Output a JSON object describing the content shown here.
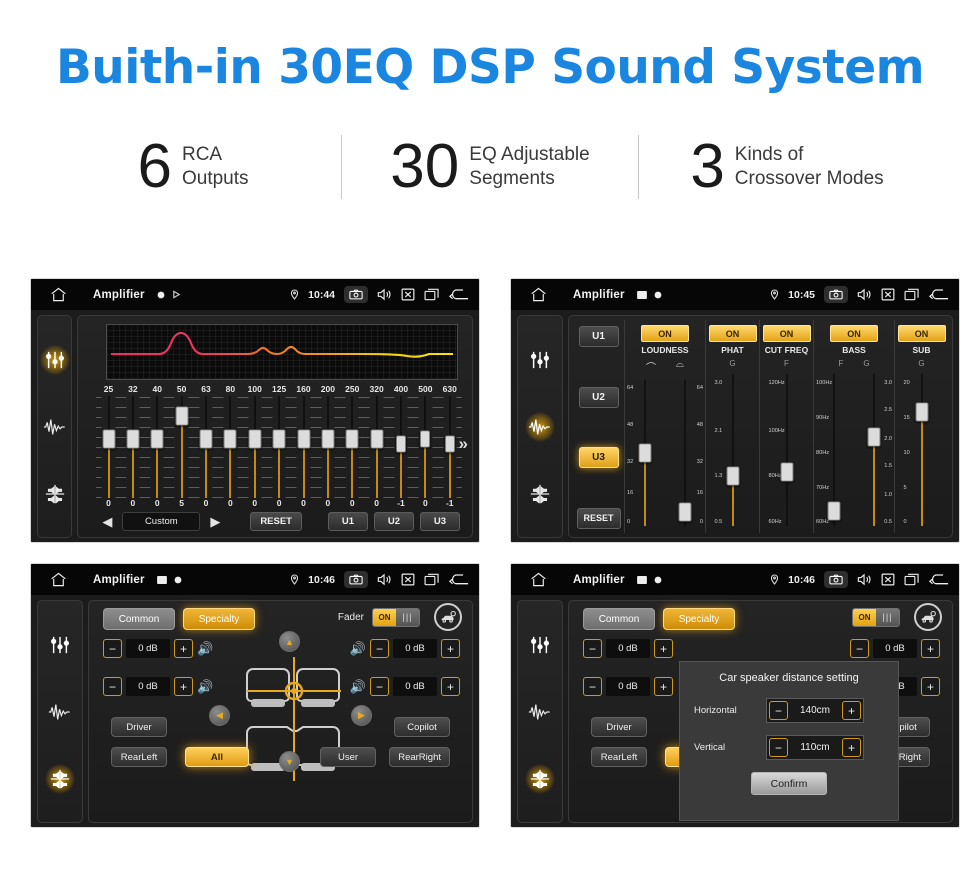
{
  "header": {
    "title": "Buith-in 30EQ DSP Sound System",
    "title_color": "#1a86e0",
    "stats": [
      {
        "number": "6",
        "line1": "RCA",
        "line2": "Outputs"
      },
      {
        "number": "30",
        "line1": "EQ Adjustable",
        "line2": "Segments"
      },
      {
        "number": "3",
        "line1": "Kinds of",
        "line2": "Crossover Modes"
      }
    ]
  },
  "accent_color": "#e8a81c",
  "panel1": {
    "statusbar": {
      "title": "Amplifier",
      "time": "10:44"
    },
    "rail": [
      {
        "icon": "eq-sliders-icon",
        "active": true
      },
      {
        "icon": "waveform-icon",
        "active": false
      },
      {
        "icon": "balance-icon",
        "active": false
      }
    ],
    "eq": {
      "bands": [
        "25",
        "32",
        "40",
        "50",
        "63",
        "80",
        "100",
        "125",
        "160",
        "200",
        "250",
        "320",
        "400",
        "500",
        "630"
      ],
      "values": [
        "0",
        "0",
        "0",
        "5",
        "0",
        "0",
        "0",
        "0",
        "0",
        "0",
        "0",
        "0",
        "-1",
        "0",
        "-1"
      ]
    },
    "controls": {
      "prev": "◀",
      "preset": "Custom",
      "next": "▶",
      "reset": "RESET",
      "u1": "U1",
      "u2": "U2",
      "u3": "U3",
      "more": "»"
    }
  },
  "panel2": {
    "statusbar": {
      "title": "Amplifier",
      "time": "10:45"
    },
    "rail": [
      {
        "icon": "eq-sliders-icon",
        "active": false
      },
      {
        "icon": "waveform-icon",
        "active": true
      },
      {
        "icon": "balance-icon",
        "active": false
      }
    ],
    "presets": [
      {
        "label": "U1",
        "active": false
      },
      {
        "label": "U2",
        "active": false
      },
      {
        "label": "U3",
        "active": true
      },
      {
        "label": "RESET",
        "active": false
      }
    ],
    "tone_columns": [
      {
        "name": "LOUDNESS",
        "state": "ON",
        "headers": [
          "⌒",
          "⌓"
        ],
        "sliders": [
          {
            "scale": [
              "64",
              "48",
              "32",
              "16",
              "0"
            ],
            "pos": 50
          },
          {
            "scale": [
              "64",
              "48",
              "32",
              "16",
              "0"
            ],
            "pos": 88
          }
        ]
      },
      {
        "name": "PHAT",
        "state": "ON",
        "headers": [
          "G"
        ],
        "sliders": [
          {
            "scale": [
              "3.0",
              "2.1",
              "1.3",
              "0.5"
            ],
            "pos": 66
          }
        ]
      },
      {
        "name": "CUT FREQ",
        "state": "ON",
        "headers": [
          "F"
        ],
        "sliders": [
          {
            "scale": [
              "120Hz",
              "100Hz",
              "80Hz",
              "60Hz"
            ],
            "pos": 64
          }
        ]
      },
      {
        "name": "BASS",
        "state": "ON",
        "headers": [
          "F",
          "G"
        ],
        "sliders": [
          {
            "scale": [
              "100Hz",
              "90Hz",
              "80Hz",
              "70Hz",
              "60Hz"
            ],
            "pos": 88
          },
          {
            "scale": [
              "3.0",
              "2.5",
              "2.0",
              "1.5",
              "1.0",
              "0.5"
            ],
            "pos": 42
          }
        ]
      },
      {
        "name": "SUB",
        "state": "ON",
        "headers": [
          "G"
        ],
        "sliders": [
          {
            "scale": [
              "20",
              "15",
              "10",
              "5",
              "0"
            ],
            "pos": 26
          }
        ]
      }
    ]
  },
  "panel3": {
    "statusbar": {
      "title": "Amplifier",
      "time": "10:46"
    },
    "rail": [
      {
        "icon": "eq-sliders-icon",
        "active": false
      },
      {
        "icon": "waveform-icon",
        "active": false
      },
      {
        "icon": "balance-icon",
        "active": true
      }
    ],
    "tabs": [
      {
        "label": "Common",
        "active": false
      },
      {
        "label": "Specialty",
        "active": true
      }
    ],
    "fader": {
      "label": "Fader",
      "state": "ON"
    },
    "steppers": [
      {
        "name": "front-left",
        "minus": "−",
        "value": "0 dB",
        "plus": "+"
      },
      {
        "name": "front-right",
        "minus": "−",
        "value": "0 dB",
        "plus": "+"
      },
      {
        "name": "rear-left",
        "minus": "−",
        "value": "0 dB",
        "plus": "+"
      },
      {
        "name": "rear-right",
        "minus": "−",
        "value": "0 dB",
        "plus": "+"
      }
    ],
    "position_buttons": [
      {
        "label": "Driver",
        "active": false
      },
      {
        "label": "Copilot",
        "active": false
      },
      {
        "label": "RearLeft",
        "active": false
      },
      {
        "label": "All",
        "active": true
      },
      {
        "label": "User",
        "active": false
      },
      {
        "label": "RearRight",
        "active": false
      }
    ]
  },
  "panel4": {
    "statusbar": {
      "title": "Amplifier",
      "time": "10:46"
    },
    "dialog": {
      "title": "Car speaker distance setting",
      "rows": [
        {
          "label": "Horizontal",
          "minus": "−",
          "value": "140cm",
          "plus": "+"
        },
        {
          "label": "Vertical",
          "minus": "−",
          "value": "110cm",
          "plus": "+"
        }
      ],
      "confirm": "Confirm"
    }
  }
}
